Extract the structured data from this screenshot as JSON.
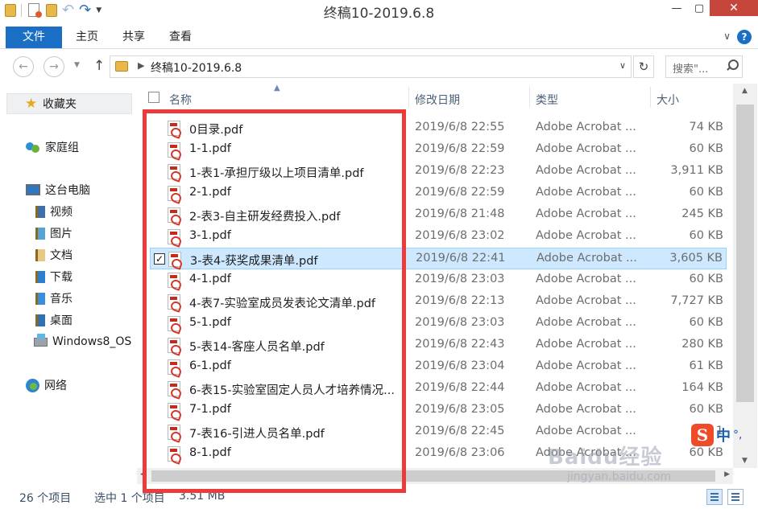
{
  "window": {
    "title": "终稿10-2019.6.8",
    "minimize": "—",
    "maximize": "▢",
    "close": "✕"
  },
  "ribbon": {
    "tabs": [
      "文件",
      "主页",
      "共享",
      "查看"
    ],
    "expand_glyph": "∨",
    "help_glyph": "?"
  },
  "address": {
    "breadcrumb": "终稿10-2019.6.8",
    "dropdown_glyph": "∨",
    "refresh_glyph": "↻",
    "search_placeholder": "搜索\"..."
  },
  "nav": {
    "favorites": "收藏夹",
    "homegroup": "家庭组",
    "this_pc": "这台电脑",
    "folders": [
      "视频",
      "图片",
      "文档",
      "下载",
      "音乐",
      "桌面"
    ],
    "drive": "Windows8_OS",
    "network": "网络"
  },
  "columns": {
    "name": "名称",
    "date": "修改日期",
    "type": "类型",
    "size": "大小"
  },
  "files": [
    {
      "name": "0目录.pdf",
      "date": "2019/6/8 22:55",
      "type": "Adobe Acrobat ...",
      "size": "74 KB"
    },
    {
      "name": "1-1.pdf",
      "date": "2019/6/8 22:59",
      "type": "Adobe Acrobat ...",
      "size": "60 KB"
    },
    {
      "name": "1-表1-承担厅级以上项目清单.pdf",
      "date": "2019/6/8 22:23",
      "type": "Adobe Acrobat ...",
      "size": "3,911 KB"
    },
    {
      "name": "2-1.pdf",
      "date": "2019/6/8 22:59",
      "type": "Adobe Acrobat ...",
      "size": "60 KB"
    },
    {
      "name": "2-表3-自主研发经费投入.pdf",
      "date": "2019/6/8 21:48",
      "type": "Adobe Acrobat ...",
      "size": "245 KB"
    },
    {
      "name": "3-1.pdf",
      "date": "2019/6/8 23:02",
      "type": "Adobe Acrobat ...",
      "size": "60 KB"
    },
    {
      "name": "3-表4-获奖成果清单.pdf",
      "date": "2019/6/8 22:41",
      "type": "Adobe Acrobat ...",
      "size": "3,605 KB",
      "selected": true
    },
    {
      "name": "4-1.pdf",
      "date": "2019/6/8 23:03",
      "type": "Adobe Acrobat ...",
      "size": "60 KB"
    },
    {
      "name": "4-表7-实验室成员发表论文清单.pdf",
      "date": "2019/6/8 22:13",
      "type": "Adobe Acrobat ...",
      "size": "7,727 KB"
    },
    {
      "name": "5-1.pdf",
      "date": "2019/6/8 23:03",
      "type": "Adobe Acrobat ...",
      "size": "60 KB"
    },
    {
      "name": "5-表14-客座人员名单.pdf",
      "date": "2019/6/8 22:43",
      "type": "Adobe Acrobat ...",
      "size": "280 KB"
    },
    {
      "name": "6-1.pdf",
      "date": "2019/6/8 23:04",
      "type": "Adobe Acrobat ...",
      "size": "61 KB"
    },
    {
      "name": "6-表15-实验室固定人员人才培养情况...",
      "date": "2019/6/8 22:44",
      "type": "Adobe Acrobat ...",
      "size": "164 KB"
    },
    {
      "name": "7-1.pdf",
      "date": "2019/6/8 23:05",
      "type": "Adobe Acrobat ...",
      "size": "60 KB"
    },
    {
      "name": "7-表16-引进人员名单.pdf",
      "date": "2019/6/8 22:45",
      "type": "Adobe Acrobat ...",
      "size": "1"
    },
    {
      "name": "8-1.pdf",
      "date": "2019/6/8 23:06",
      "type": "Adobe Acrobat ...",
      "size": "60 KB"
    }
  ],
  "status": {
    "item_count": "26 个项目",
    "selection": "选中 1 个项目",
    "selection_size": "3.51 MB"
  },
  "overlay": {
    "ime_logo": "S",
    "ime_mode": "中",
    "ime_punct": "°,",
    "watermark": "Baidu经验",
    "watermark_url": "jingyan.baidu.com"
  },
  "colors": {
    "accent": "#1a6fc4",
    "selection": "#cde8ff",
    "highlight_frame": "#ee3a3a",
    "close_button": "#c7463b"
  }
}
